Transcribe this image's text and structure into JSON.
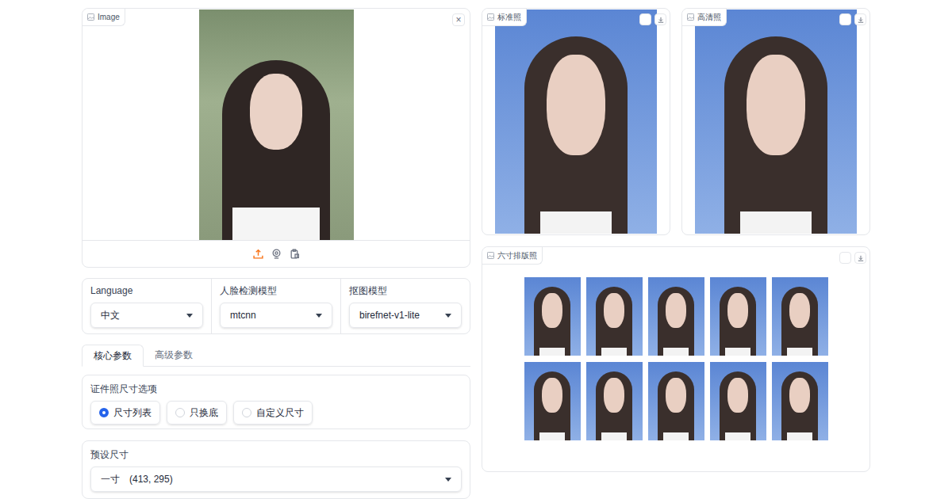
{
  "input_panel": {
    "label": "Image",
    "close": "×"
  },
  "model_row": [
    {
      "label": "Language",
      "value": "中文"
    },
    {
      "label": "人脸检测模型",
      "value": "mtcnn"
    },
    {
      "label": "抠图模型",
      "value": "birefnet-v1-lite"
    }
  ],
  "tabs": [
    {
      "label": "核心参数",
      "selected": true
    },
    {
      "label": "高级参数",
      "selected": false
    }
  ],
  "size_options": {
    "title": "证件照尺寸选项",
    "radios": [
      {
        "label": "尺寸列表",
        "selected": true
      },
      {
        "label": "只换底",
        "selected": false
      },
      {
        "label": "自定义尺寸",
        "selected": false
      }
    ]
  },
  "preset": {
    "label": "预设尺寸",
    "name": "一寸",
    "size": "(413, 295)"
  },
  "outputs": [
    {
      "label": "标准照"
    },
    {
      "label": "高清照"
    }
  ],
  "layout_panel": {
    "label": "六寸排版照",
    "tiles": 10
  }
}
